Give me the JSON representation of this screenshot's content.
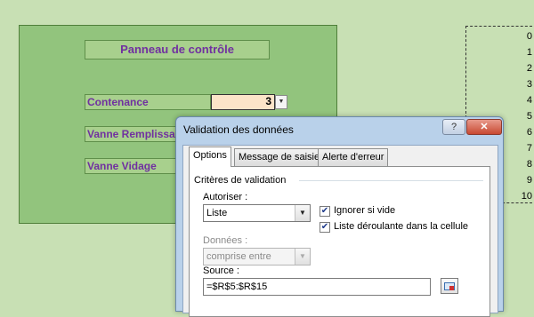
{
  "panel": {
    "title": "Panneau de contrôle",
    "contenance_label": "Contenance",
    "contenance_value": "3",
    "vanne_remplissage_label": "Vanne Remplissage",
    "vanne_vidage_label": "Vanne Vidage"
  },
  "range_values": [
    "0",
    "1",
    "2",
    "3",
    "4",
    "5",
    "6",
    "7",
    "8",
    "9",
    "10"
  ],
  "dialog": {
    "title": "Validation des données",
    "help_label": "?",
    "close_label": "✕",
    "tabs": [
      "Options",
      "Message de saisie",
      "Alerte d'erreur"
    ],
    "criteria_heading": "Critères de validation",
    "autoriser_label": "Autoriser :",
    "autoriser_value": "Liste",
    "ignorer_label": "Ignorer si vide",
    "ignorer_checked": true,
    "liste_deroulante_label": "Liste déroulante dans la cellule",
    "liste_deroulante_checked": true,
    "donnees_label": "Données :",
    "donnees_value": "comprise entre",
    "source_label": "Source :",
    "source_value": "=$R$5:$R$15"
  },
  "colors": {
    "sheet_bg": "#c8e0b4",
    "panel_bg": "#92c47d",
    "label_text": "#7030a0",
    "value_cell_bg": "#fce4c8"
  },
  "icons": {
    "dropdown": "chevron-down-icon",
    "range_picker": "collapse-dialog-icon"
  }
}
